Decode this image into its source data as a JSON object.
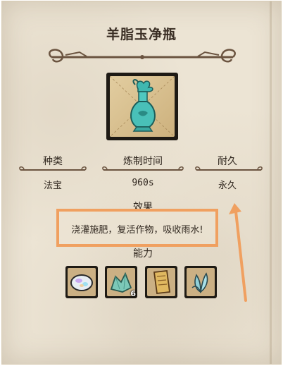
{
  "item": {
    "title": "羊脂玉净瓶",
    "icon": "jade-vase-icon"
  },
  "stats": [
    {
      "label": "种类",
      "value": "法宝"
    },
    {
      "label": "炼制时间",
      "value": "960s"
    },
    {
      "label": "耐久",
      "value": "永久"
    }
  ],
  "effect": {
    "label": "效果",
    "text": "浇灌施肥，复活作物，吸收雨水!"
  },
  "ability": {
    "label": "能力"
  },
  "recipe": [
    {
      "icon": "opal-gem-icon",
      "count": ""
    },
    {
      "icon": "jade-crystal-icon",
      "count": "6"
    },
    {
      "icon": "paper-scroll-icon",
      "count": ""
    },
    {
      "icon": "crystal-flower-icon",
      "count": ""
    }
  ],
  "colors": {
    "highlight": "#f0a060",
    "parchment": "#ece4d4",
    "frame": "#1e1a14",
    "jade": "#3fb8b0"
  }
}
